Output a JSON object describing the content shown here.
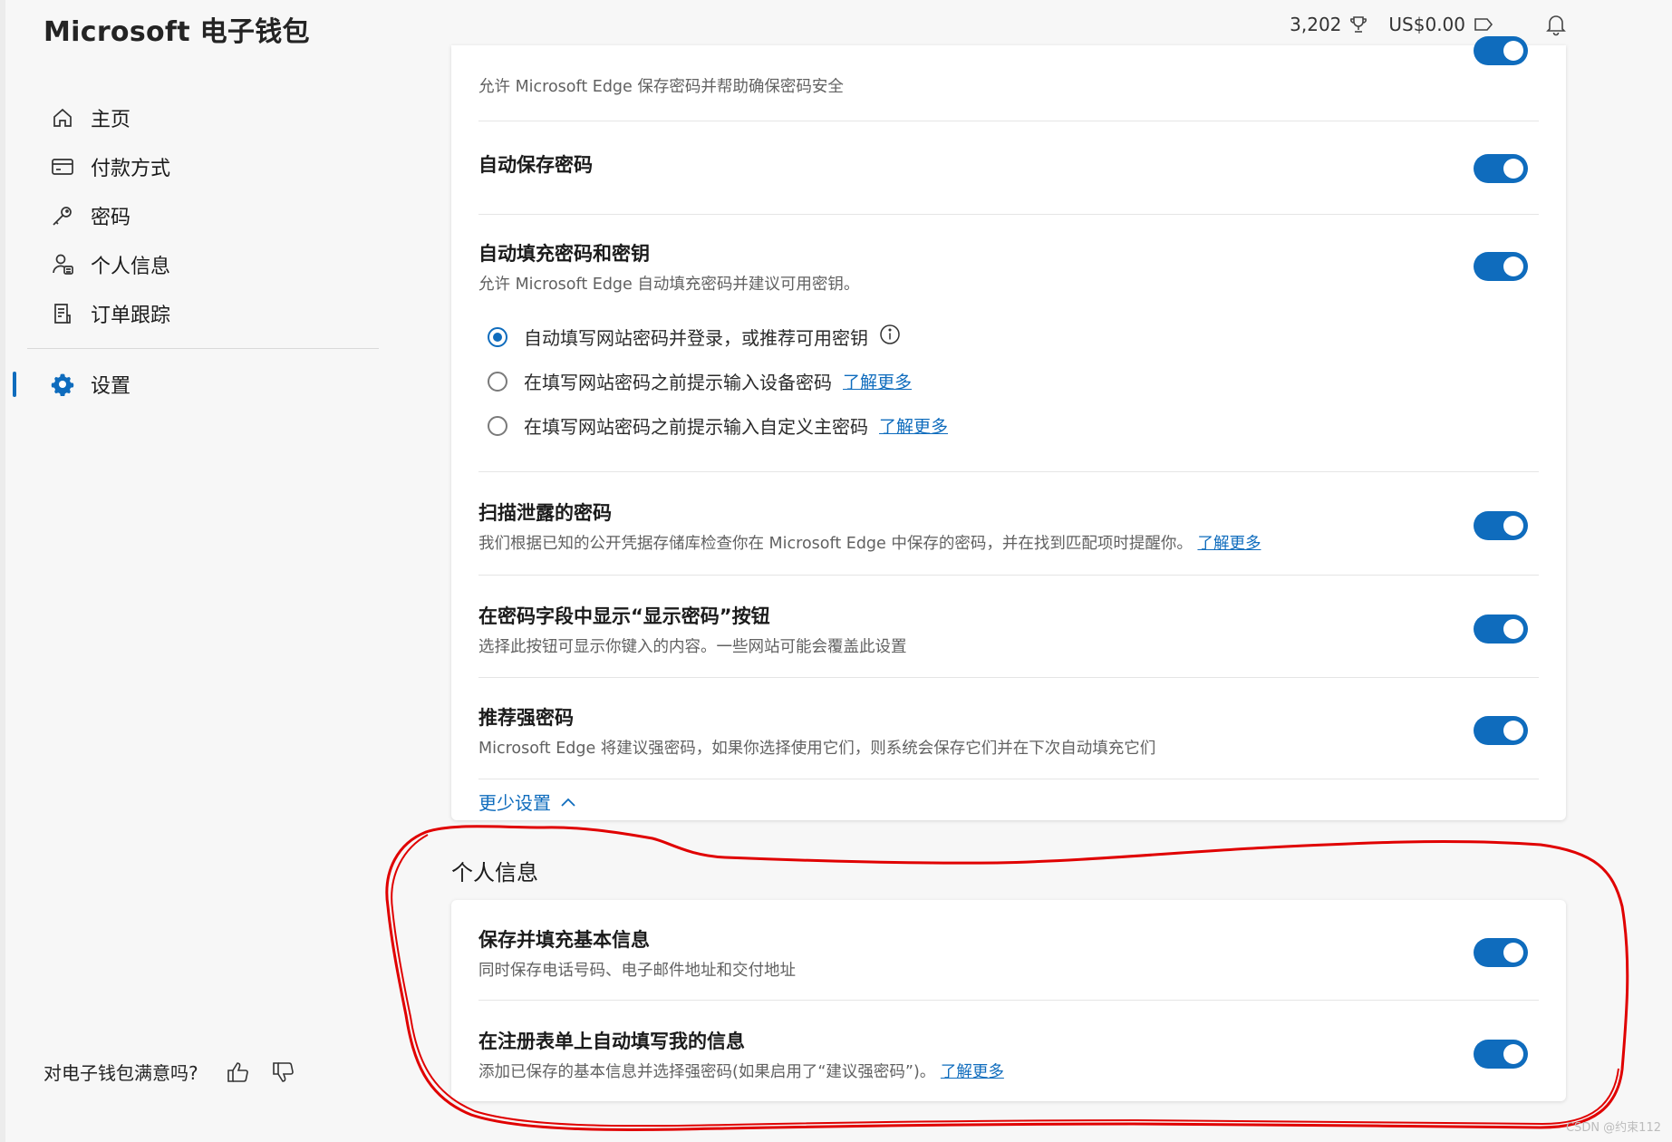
{
  "app": {
    "title": "Microsoft 电子钱包"
  },
  "header": {
    "points": "3,202",
    "balance": "US$0.00"
  },
  "sidebar": {
    "items": [
      {
        "label": "主页",
        "icon": "home-icon"
      },
      {
        "label": "付款方式",
        "icon": "card-icon"
      },
      {
        "label": "密码",
        "icon": "key-icon"
      },
      {
        "label": "个人信息",
        "icon": "person-icon"
      },
      {
        "label": "订单跟踪",
        "icon": "receipt-icon"
      }
    ],
    "settings": {
      "label": "设置",
      "icon": "gear-icon",
      "active": true
    }
  },
  "feedback": {
    "question": "对电子钱包满意吗?"
  },
  "passwords": {
    "partial_desc": "允许 Microsoft Edge 保存密码并帮助确保密码安全",
    "auto_save": {
      "title": "自动保存密码",
      "enabled": true
    },
    "autofill": {
      "title": "自动填充密码和密钥",
      "desc": "允许 Microsoft Edge 自动填充密码并建议可用密钥。",
      "enabled": true,
      "options": [
        {
          "label": "自动填写网站密码并登录，或推荐可用密钥",
          "checked": true
        },
        {
          "label": "在填写网站密码之前提示输入设备密码",
          "link": "了解更多",
          "checked": false
        },
        {
          "label": "在填写网站密码之前提示输入自定义主密码",
          "link": "了解更多",
          "checked": false
        }
      ]
    },
    "leak_scan": {
      "title": "扫描泄露的密码",
      "desc": "我们根据已知的公开凭据存储库检查你在 Microsoft Edge 中保存的密码，并在找到匹配项时提醒你。",
      "link": "了解更多",
      "enabled": true
    },
    "reveal_button": {
      "title": "在密码字段中显示“显示密码”按钮",
      "desc": "选择此按钮可显示你键入的内容。一些网站可能会覆盖此设置",
      "enabled": true
    },
    "strong_password": {
      "title": "推荐强密码",
      "desc": "Microsoft Edge 将建议强密码，如果你选择使用它们，则系统会保存它们并在下次自动填充它们",
      "enabled": true
    },
    "less_settings": "更少设置"
  },
  "personal_info": {
    "heading": "个人信息",
    "save_basic": {
      "title": "保存并填充基本信息",
      "desc": "同时保存电话号码、电子邮件地址和交付地址",
      "enabled": true
    },
    "autofill_signup": {
      "title": "在注册表单上自动填写我的信息",
      "desc": "添加已保存的基本信息并选择强密码(如果启用了“建议强密码”)。",
      "link": "了解更多",
      "enabled": true
    }
  },
  "watermark": "CSDN @约束112",
  "colors": {
    "accent": "#0f6cbd",
    "annotation": "#e00000"
  }
}
